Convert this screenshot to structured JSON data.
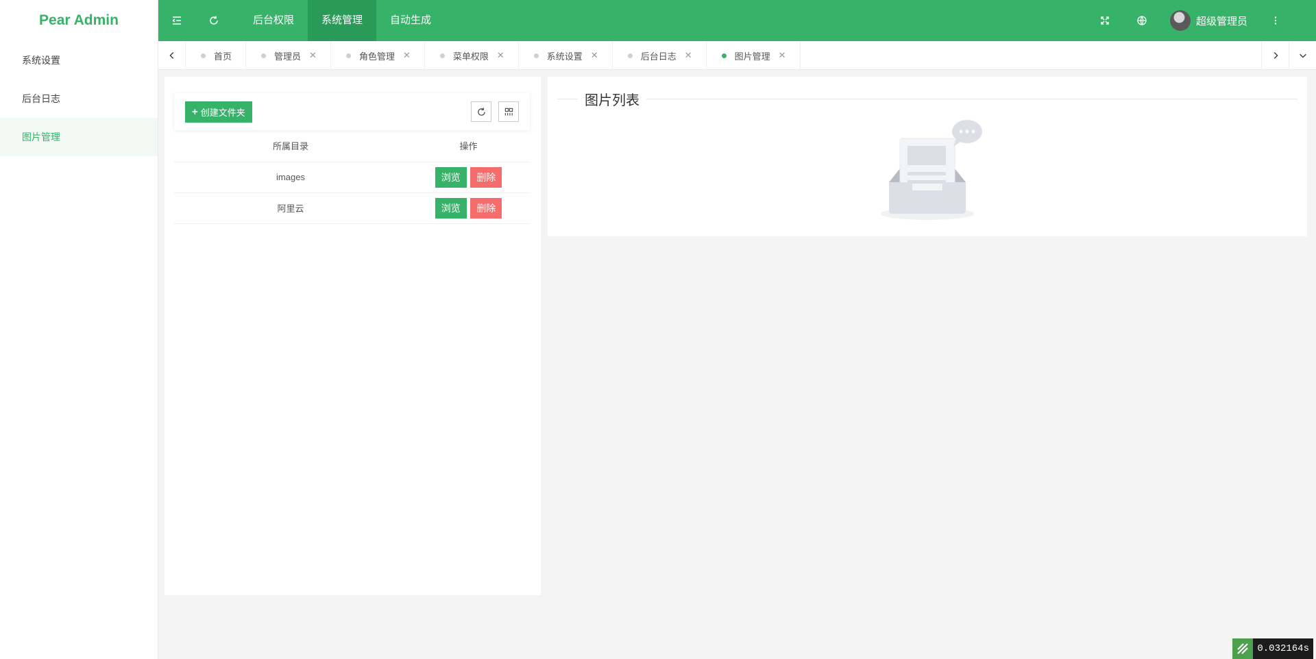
{
  "app": {
    "title": "Pear Admin"
  },
  "sidebar": {
    "items": [
      {
        "label": "系统设置",
        "active": false
      },
      {
        "label": "后台日志",
        "active": false
      },
      {
        "label": "图片管理",
        "active": true
      }
    ]
  },
  "header": {
    "nav": [
      {
        "label": "后台权限"
      },
      {
        "label": "系统管理"
      },
      {
        "label": "自动生成"
      }
    ],
    "user_name": "超级管理员"
  },
  "tabs": [
    {
      "label": "首页",
      "closable": false
    },
    {
      "label": "管理员",
      "closable": true
    },
    {
      "label": "角色管理",
      "closable": true
    },
    {
      "label": "菜单权限",
      "closable": true
    },
    {
      "label": "系统设置",
      "closable": true
    },
    {
      "label": "后台日志",
      "closable": true
    },
    {
      "label": "图片管理",
      "closable": true
    }
  ],
  "active_tab": "图片管理",
  "folder_panel": {
    "create_label": "创建文件夹",
    "columns": [
      "所属目录",
      "操作"
    ],
    "rows": [
      {
        "dir": "images"
      },
      {
        "dir": "阿里云"
      }
    ],
    "browse_label": "浏览",
    "delete_label": "删除"
  },
  "image_panel": {
    "title": "图片列表"
  },
  "timer": {
    "value": "0.032164s"
  },
  "colors": {
    "primary": "#36b368",
    "danger": "#f56c6c"
  },
  "icons": {
    "header": [
      "menu-fold-icon",
      "refresh-icon",
      "fullscreen-icon",
      "globe-icon",
      "more-vertical-icon"
    ],
    "tabs": [
      "chevron-left-icon",
      "chevron-right-icon",
      "chevron-down-icon"
    ]
  }
}
